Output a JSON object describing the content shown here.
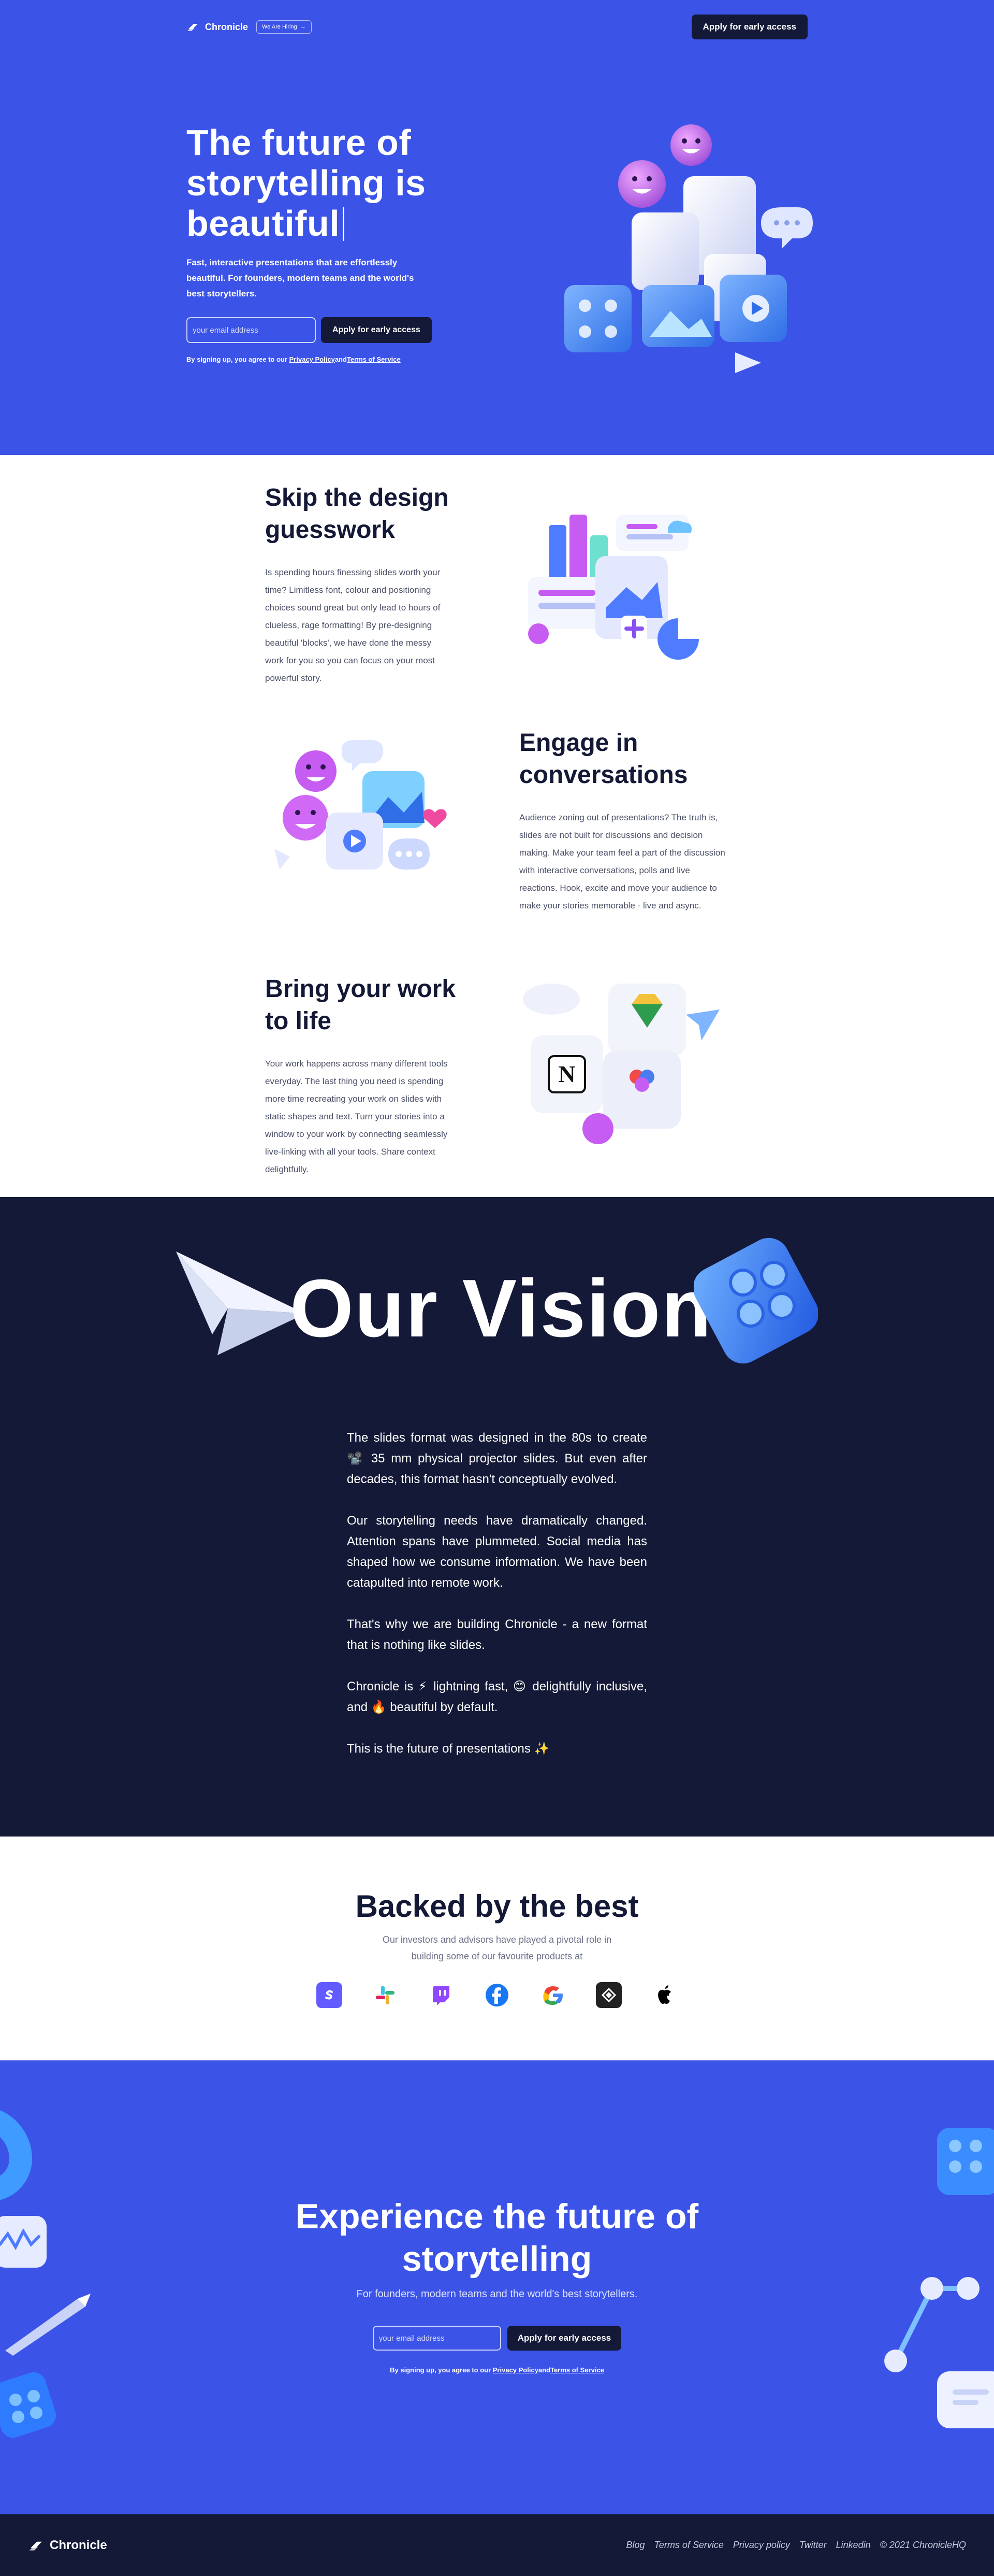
{
  "colors": {
    "brand_blue": "#3b53e6",
    "navy": "#141937",
    "white": "#ffffff",
    "accent_purple": "#b05bf0"
  },
  "nav": {
    "brand": "Chronicle",
    "hiring_label": "We Are Hiring",
    "hiring_icon": "arrow-right-icon",
    "cta_label": "Apply for early access"
  },
  "hero": {
    "title": "The future of storytelling is beautiful",
    "subtitle": "Fast, interactive presentations that are effortlessly beautiful. For founders, modern teams and the world's best storytellers.",
    "email_placeholder": "your email address",
    "cta_label": "Apply for early access",
    "legal_prefix": "By signing up, you agree to our",
    "privacy_label": "Privacy Policy",
    "and_label": "and",
    "terms_label": "Terms of Service"
  },
  "features": [
    {
      "title": "Skip the design guesswork",
      "body": "Is spending hours finessing slides worth your time? Limitless font, colour and positioning choices sound great but only lead to hours of clueless, rage formatting! By pre-designing beautiful 'blocks', we have done the messy work for you so you can focus on your most powerful story."
    },
    {
      "title": "Engage in conversations",
      "body": "Audience zoning out of presentations? The truth is, slides are not built for discussions and decision making. Make your team feel a part of the discussion with interactive conversations, polls and live reactions. Hook, excite and move your audience to make your stories memorable - live and async."
    },
    {
      "title": "Bring your work to life",
      "body": "Your work happens across many different tools everyday. The last thing you need is spending more time recreating your work on slides with static shapes and text. Turn your stories into a window to your work by connecting seamlessly live-linking with all your tools. Share context delightfully."
    }
  ],
  "vision": {
    "title": "Our Vision",
    "paragraphs": [
      "The slides format was designed in the 80s to create 📽️ 35 mm physical projector slides. But even after decades, this format hasn't conceptually evolved.",
      "Our storytelling needs have dramatically changed. Attention spans have plummeted. Social media has shaped how we consume information. We have been catapulted into remote work.",
      "That's why we are building Chronicle - a new format that is nothing like slides.",
      "Chronicle is ⚡ lightning fast, 😊 delightfully inclusive, and 🔥 beautiful by default.",
      "This is the future of presentations ✨"
    ]
  },
  "backers": {
    "title": "Backed by the best",
    "subtitle": "Our investors and advisors have played a pivotal role in building some of our favourite products at",
    "logos": [
      "stripe-icon",
      "slack-icon",
      "twitch-icon",
      "facebook-icon",
      "google-icon",
      "sketch-icon",
      "apple-icon"
    ]
  },
  "cta": {
    "title": "Experience the future of storytelling",
    "subtitle": "For founders, modern teams and the world's best storytellers.",
    "email_placeholder": "your email address",
    "cta_label": "Apply for early access",
    "legal_prefix": "By signing up, you agree to our",
    "privacy_label": "Privacy Policy",
    "and_label": "and",
    "terms_label": "Terms of Service"
  },
  "footer": {
    "brand": "Chronicle",
    "links": [
      "Blog",
      "Terms of Service",
      "Privacy policy",
      "Twitter",
      "Linkedin"
    ],
    "copyright": "© 2021 ChronicleHQ"
  }
}
